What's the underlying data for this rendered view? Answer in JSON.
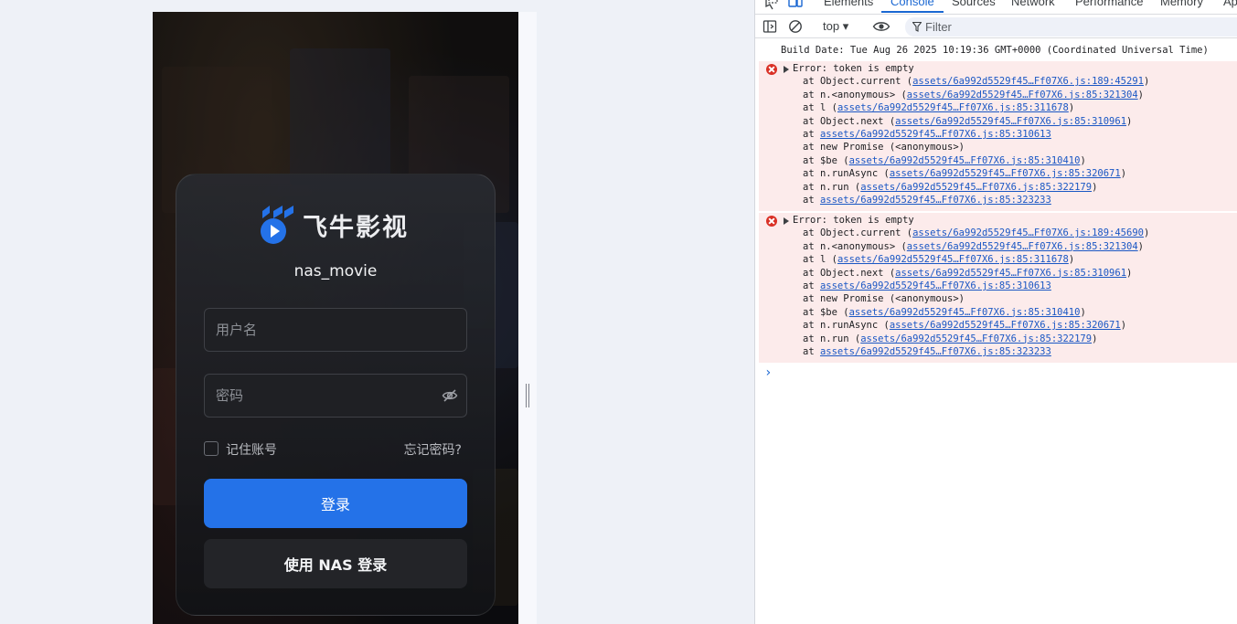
{
  "login": {
    "brand_name": "飞牛影视",
    "server_name": "nas_movie",
    "username_placeholder": "用户名",
    "password_placeholder": "密码",
    "remember_label": "记住账号",
    "forgot_label": "忘记密码?",
    "login_label": "登录",
    "nas_login_label": "使用 NAS 登录",
    "colors": {
      "primary": "#2472e8",
      "card": "#1c1d21"
    }
  },
  "devtools": {
    "tabs": [
      {
        "label": "Elements"
      },
      {
        "label": "Console",
        "active": true
      },
      {
        "label": "Sources"
      },
      {
        "label": "Network"
      },
      {
        "label": "Performance"
      },
      {
        "label": "Memory"
      },
      {
        "label": "Ap"
      }
    ],
    "toolbar": {
      "context": "top",
      "filter_placeholder": "Filter",
      "icons": [
        "sidebar-toggle-icon",
        "clear-console-icon",
        "eye-icon",
        "filter-icon"
      ]
    },
    "console": {
      "build_line": "Build Date: Tue Aug 26 2025 10:19:36 GMT+0000 (Coordinated Universal Time)",
      "errors": [
        {
          "message": "Error: token is empty",
          "frames": [
            {
              "prefix": "at Object.current (",
              "link": "assets/6a992d5529f45…Ff07X6.js:189:45291",
              "suffix": ")"
            },
            {
              "prefix": "at n.<anonymous> (",
              "link": "assets/6a992d5529f45…Ff07X6.js:85:321304",
              "suffix": ")"
            },
            {
              "prefix": "at l (",
              "link": "assets/6a992d5529f45…Ff07X6.js:85:311678",
              "suffix": ")"
            },
            {
              "prefix": "at Object.next (",
              "link": "assets/6a992d5529f45…Ff07X6.js:85:310961",
              "suffix": ")"
            },
            {
              "prefix": "at ",
              "link": "assets/6a992d5529f45…Ff07X6.js:85:310613",
              "suffix": ""
            },
            {
              "prefix": "at new Promise (<anonymous>)",
              "link": "",
              "suffix": ""
            },
            {
              "prefix": "at $be (",
              "link": "assets/6a992d5529f45…Ff07X6.js:85:310410",
              "suffix": ")"
            },
            {
              "prefix": "at n.runAsync (",
              "link": "assets/6a992d5529f45…Ff07X6.js:85:320671",
              "suffix": ")"
            },
            {
              "prefix": "at n.run (",
              "link": "assets/6a992d5529f45…Ff07X6.js:85:322179",
              "suffix": ")"
            },
            {
              "prefix": "at ",
              "link": "assets/6a992d5529f45…Ff07X6.js:85:323233",
              "suffix": ""
            }
          ]
        },
        {
          "message": "Error: token is empty",
          "frames": [
            {
              "prefix": "at Object.current (",
              "link": "assets/6a992d5529f45…Ff07X6.js:189:45690",
              "suffix": ")"
            },
            {
              "prefix": "at n.<anonymous> (",
              "link": "assets/6a992d5529f45…Ff07X6.js:85:321304",
              "suffix": ")"
            },
            {
              "prefix": "at l (",
              "link": "assets/6a992d5529f45…Ff07X6.js:85:311678",
              "suffix": ")"
            },
            {
              "prefix": "at Object.next (",
              "link": "assets/6a992d5529f45…Ff07X6.js:85:310961",
              "suffix": ")"
            },
            {
              "prefix": "at ",
              "link": "assets/6a992d5529f45…Ff07X6.js:85:310613",
              "suffix": ""
            },
            {
              "prefix": "at new Promise (<anonymous>)",
              "link": "",
              "suffix": ""
            },
            {
              "prefix": "at $be (",
              "link": "assets/6a992d5529f45…Ff07X6.js:85:310410",
              "suffix": ")"
            },
            {
              "prefix": "at n.runAsync (",
              "link": "assets/6a992d5529f45…Ff07X6.js:85:320671",
              "suffix": ")"
            },
            {
              "prefix": "at n.run (",
              "link": "assets/6a992d5529f45…Ff07X6.js:85:322179",
              "suffix": ")"
            },
            {
              "prefix": "at ",
              "link": "assets/6a992d5529f45…Ff07X6.js:85:323233",
              "suffix": ""
            }
          ]
        }
      ]
    }
  }
}
